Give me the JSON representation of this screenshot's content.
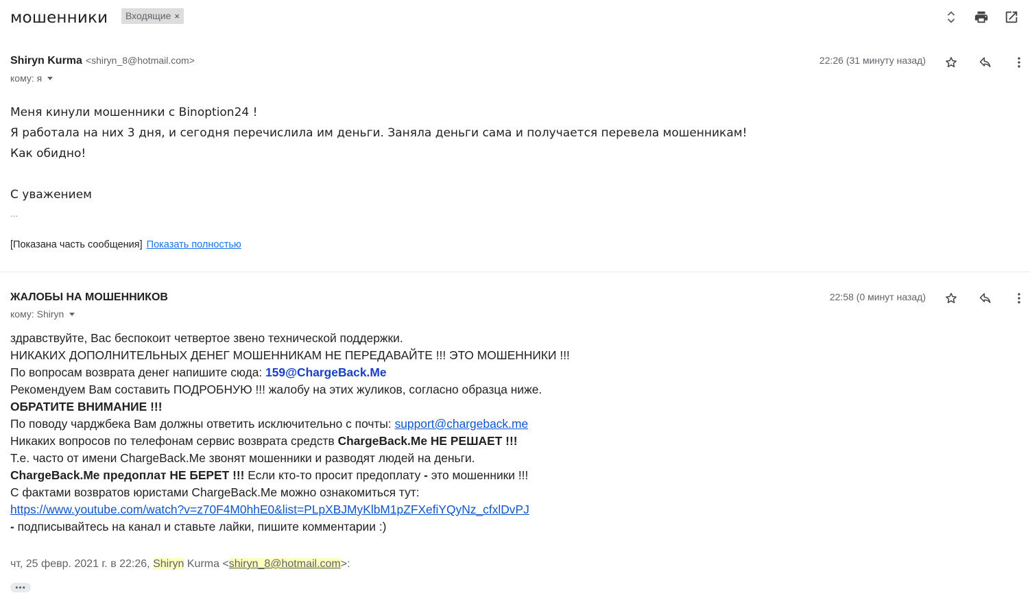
{
  "subject": {
    "title": "мошенники",
    "label": "Входящие",
    "label_close": "×"
  },
  "toolbar": {
    "icons": [
      "expand-collapse-icon",
      "print-icon",
      "open-new-window-icon"
    ]
  },
  "message1": {
    "sender_name": "Shiryn Kurma",
    "sender_email": "<shiryn_8@hotmail.com>",
    "to": "кому: я",
    "time": "22:26 (31 минуту назад)",
    "body": [
      "Меня кинули мошенники с Binoption24 !",
      "Я работала на них 3 дня, и сегодня перечислила им деньги. Заняла деньги сама и получается перевела мошенникам!",
      "Как обидно!",
      "",
      "С уважением"
    ],
    "ellipsis": "...",
    "partial_notice": "[Показана часть сообщения]",
    "show_full": "Показать полностью"
  },
  "message2": {
    "sender_name": "ЖАЛОБЫ НА МОШЕННИКОВ",
    "to": "кому: Shiryn",
    "time": "22:58 (0 минут назад)",
    "lines": {
      "l1": "здравствуйте, Вас беспокоит четвертое звено технической поддержки.",
      "l2": "НИКАКИХ ДОПОЛНИТЕЛЬНЫХ ДЕНЕГ МОШЕННИКАМ НЕ ПЕРЕДАВАЙТЕ !!! ЭТО МОШЕННИКИ !!!",
      "l3_text": "По вопросам возврата денег напишите сюда: ",
      "l3_email": "159@ChargeBack.Me",
      "l4": "Рекомендуем Вам составить ПОДРОБНУЮ !!! жалобу на этих жуликов, согласно образца ниже.",
      "l5": "ОБРАТИТЕ ВНИМАНИЕ !!!",
      "l6_text": "По поводу чарджбека Вам должны ответить исключительно с почты: ",
      "l6_link": "support@chargeback.me",
      "l7_text": "Никаких вопросов по телефонам сервис возврата средств ",
      "l7_bold": "ChargeBack.Me НЕ РЕШАЕТ !!!",
      "l8": "Т.е. часто от имени ChargeBack.Me звонят мошенники и разводят людей на деньги.",
      "l9_bold": "ChargeBack.Me предоплат НЕ БЕРЕТ !!!",
      "l9_text": " Если кто-то просит предоплату ",
      "l9_dash": "-",
      "l9_tail": " это мошенники !!!",
      "l10": "С фактами возвратов юристами ChargeBack.Me можно ознакомиться тут:",
      "l11_link": "https://www.youtube.com/watch?v=z70F4M0hhE0&list=PLpXBJMyKlbM1pZFXefiYQyNz_cfxlDvPJ",
      "l12_dash": " -",
      "l12_text": " подписывайтесь на канал и ставьте лайки, пишите комментарии :)"
    },
    "quote": {
      "date": "чт, 25 февр. 2021 г. в 22:26, ",
      "name_hl": "Shiryn",
      "name_rest": " Kurma <",
      "email": "shiryn_8@hotmail.com",
      "end": ">:"
    },
    "more": "•••"
  },
  "colors": {
    "link": "#1155cc",
    "email_bold_blue": "#1b3fc4",
    "highlight": "#ffffc0"
  }
}
